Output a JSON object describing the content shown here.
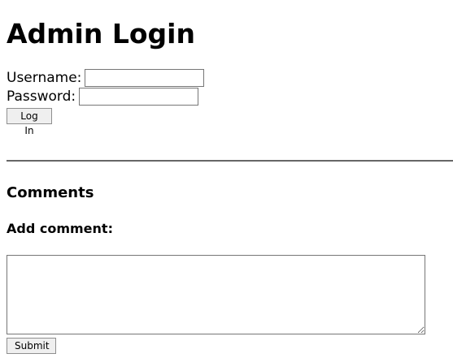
{
  "login": {
    "heading": "Admin Login",
    "username_label": "Username:",
    "username_value": "",
    "password_label": "Password:",
    "password_value": "",
    "login_button": "Log In"
  },
  "comments": {
    "heading": "Comments",
    "add_heading": "Add comment:",
    "comment_value": "",
    "submit_button": "Submit"
  }
}
